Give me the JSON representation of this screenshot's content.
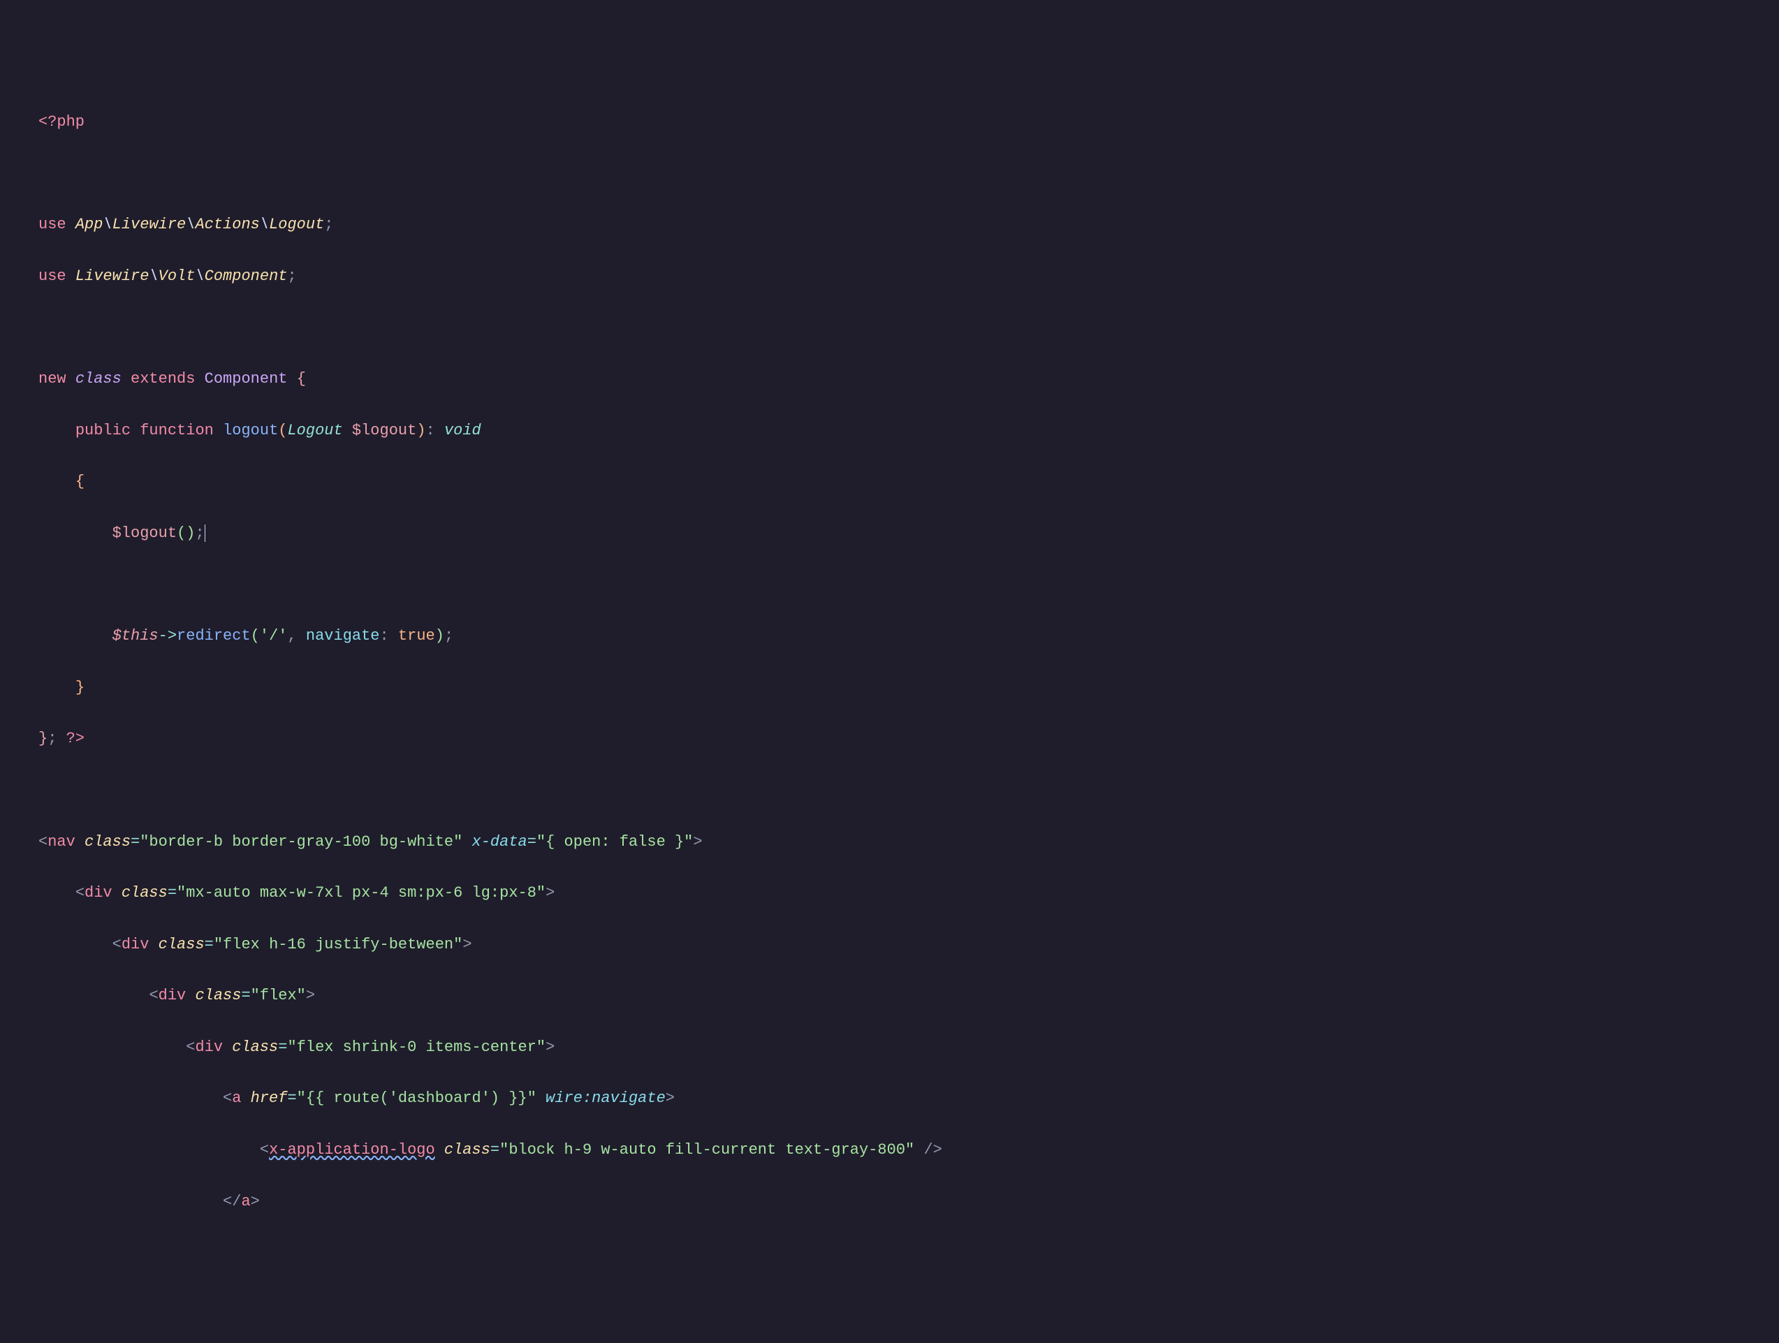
{
  "code": {
    "php_open": "<?php",
    "use1": {
      "kw": "use",
      "ns": [
        "App",
        "Livewire",
        "Actions",
        "Logout"
      ]
    },
    "use2": {
      "kw": "use",
      "ns": [
        "Livewire",
        "Volt",
        "Component"
      ]
    },
    "class_decl": {
      "new": "new",
      "class": "class",
      "extends": "extends",
      "parent": "Component"
    },
    "method": {
      "vis": "public",
      "fn_kw": "function",
      "name": "logout",
      "param_type": "Logout",
      "param_var": "$logout",
      "ret": "void"
    },
    "body1": {
      "var": "$logout",
      "call": "()",
      "semi": ";"
    },
    "body2": {
      "this": "$this",
      "arrow": "->",
      "fn": "redirect",
      "arg1": "'/'",
      "named": "navigate",
      "colon": ":",
      "val": "true",
      "semi": ";"
    },
    "php_close": "?>",
    "nav": {
      "tag": "nav",
      "class_attr": "class",
      "class_val": "\"border-b border-gray-100 bg-white\"",
      "xdata_attr": "x-data",
      "xdata_val": "\"{ open: false }\""
    },
    "div1": {
      "tag": "div",
      "class_attr": "class",
      "class_val": "\"mx-auto max-w-7xl px-4 sm:px-6 lg:px-8\""
    },
    "div2": {
      "tag": "div",
      "class_attr": "class",
      "class_val": "\"flex h-16 justify-between\""
    },
    "div3": {
      "tag": "div",
      "class_attr": "class",
      "class_val": "\"flex\""
    },
    "div4": {
      "tag": "div",
      "class_attr": "class",
      "class_val": "\"flex shrink-0 items-center\""
    },
    "a": {
      "tag": "a",
      "href_attr": "href",
      "href_val": "\"{{ route('dashboard') }}\"",
      "wire_attr": "wire:navigate"
    },
    "logo": {
      "tag": "x-application-logo",
      "class_attr": "class",
      "class_val": "\"block h-9 w-auto fill-current text-gray-800\""
    },
    "a_close": "a"
  }
}
